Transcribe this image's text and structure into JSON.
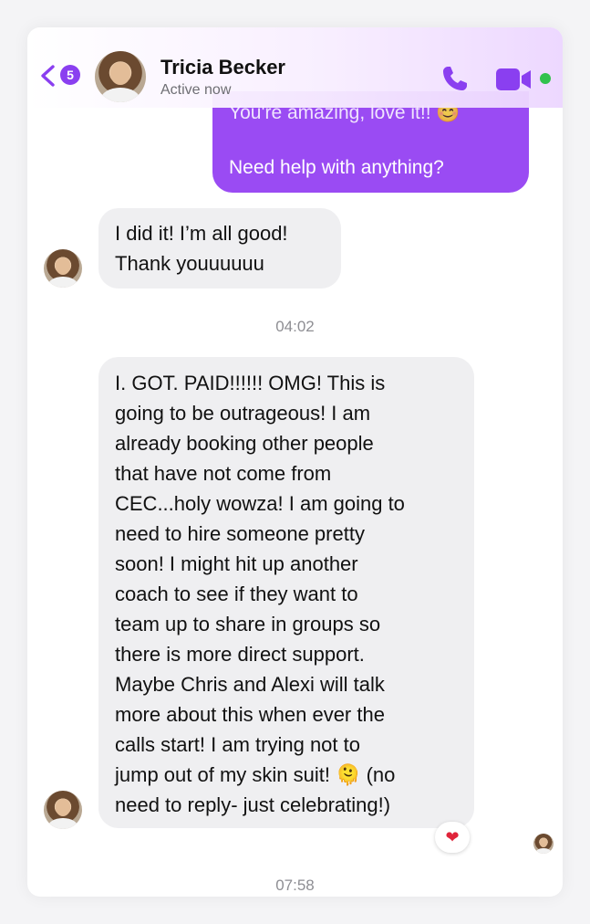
{
  "header": {
    "unread_count": "5",
    "contact_name": "Tricia Becker",
    "status": "Active now"
  },
  "messages": {
    "outgoing_line1": "You're amazing, love it!! 😊",
    "outgoing_line2": "Need help with anything?",
    "incoming1": [
      "I did it! I’m all good!",
      "Thank youuuuuu"
    ],
    "time1": "04:02",
    "incoming2": [
      "I. GOT. PAID!!!!!!  OMG! This is",
      "going to be outrageous!  I am",
      "already booking other people",
      "that have not come from",
      "CEC...holy wowza!  I am going to",
      "need to hire someone pretty",
      "soon!  I might hit up another",
      "coach to see if they want to",
      "team up to share in groups so",
      "there is more direct support.",
      "Maybe Chris and Alexi will talk",
      "more about this when ever the",
      "calls start!  I am trying not to",
      "jump out of my skin suit! 🫠   (no",
      "need to reply- just celebrating!)"
    ],
    "reaction": "❤",
    "time2": "07:58"
  },
  "colors": {
    "accent": "#9a4bf3",
    "online": "#31c24d",
    "incoming_bubble": "#efeff1"
  },
  "icons": [
    "back-chevron-icon",
    "phone-icon",
    "video-camera-icon"
  ]
}
